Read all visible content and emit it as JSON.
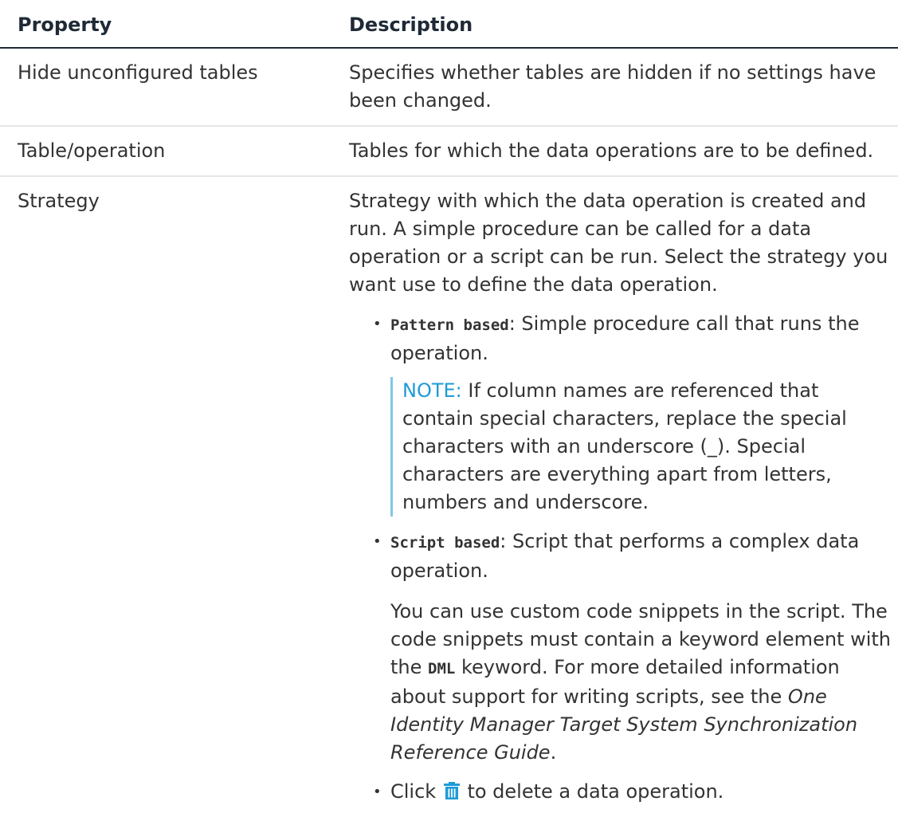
{
  "header": {
    "property": "Property",
    "description": "Description"
  },
  "rows": [
    {
      "property": "Hide unconfigured tables",
      "description": "Specifies whether tables are hidden if no settings have been changed."
    },
    {
      "property": "Table/operation",
      "description": "Tables for which the data operations are to be defined."
    },
    {
      "property": "Strategy",
      "description": "Strategy with which the data operation is created and run. A simple procedure can be called for a data operation or a script can be run. Select the strategy you want use to define the data operation.",
      "options": {
        "pattern": {
          "keyword": "Pattern based",
          "text": ": Simple procedure call that runs the operation."
        },
        "note": {
          "label": "NOTE:",
          "text": " If column names are referenced that contain special characters, replace the special characters with an underscore (_). Special characters are everything apart from letters, numbers and underscore."
        },
        "script": {
          "keyword": "Script based",
          "text": ": Script that performs a complex data operation."
        },
        "snippets": {
          "text1": "You can use custom code snippets in the script. The code snippets must contain a keyword element with the ",
          "keyword": "DML",
          "text2": " keyword. For more detailed information about support for writing scripts, see the ",
          "guide": "One Identity Manager Target System Synchronization Reference Guide",
          "text3": "."
        },
        "delete": {
          "text1": "Click",
          "icon": "trash-icon",
          "text2": " to delete a data operation."
        }
      }
    }
  ],
  "colors": {
    "icon": "#1e9bd7",
    "note_label": "#1e9bd7",
    "text": "#333333"
  }
}
